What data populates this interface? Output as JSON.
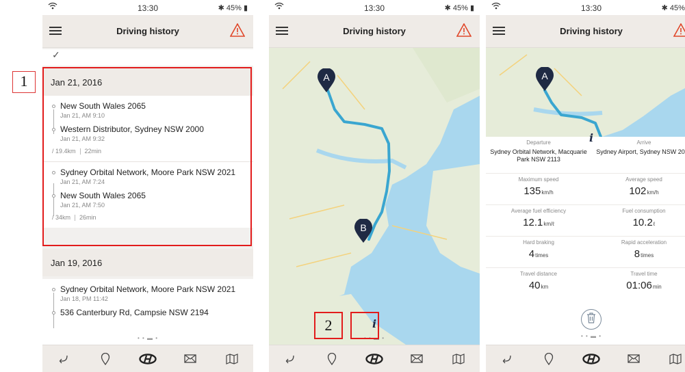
{
  "status": {
    "time": "13:30",
    "battery": "45%"
  },
  "header": {
    "title": "Driving history"
  },
  "history": {
    "groups": [
      {
        "date": "Jan 21, 2016",
        "trips": [
          {
            "start": {
              "place": "New South Wales 2065",
              "time": "Jan 21, AM 9:10"
            },
            "end": {
              "place": "Western Distributor, Sydney NSW 2000",
              "time": "Jan 21, AM 9:32"
            },
            "distance": "19.4km",
            "duration": "22min"
          },
          {
            "start": {
              "place": "Sydney Orbital Network, Moore Park NSW 2021",
              "time": "Jan 21, AM 7:24"
            },
            "end": {
              "place": "New South Wales 2065",
              "time": "Jan 21, AM 7:50"
            },
            "distance": "34km",
            "duration": "26min"
          }
        ]
      },
      {
        "date": "Jan 19, 2016",
        "trips": [
          {
            "start": {
              "place": "Sydney Orbital Network, Moore Park NSW 2021",
              "time": "Jan 18, PM 11:42"
            },
            "end": {
              "place": "536 Canterbury Rd, Campsie NSW 2194",
              "time": ""
            }
          }
        ]
      }
    ]
  },
  "map": {
    "marker_a": "A",
    "marker_b": "B",
    "route_color": "#3aa6d0",
    "water_color": "#a9d7ee",
    "land_color": "#e8eedf",
    "info_label": "i"
  },
  "details": {
    "departure_label": "Departure",
    "departure_value": "Sydney Orbital Network, Macquarie Park NSW 2113",
    "arrive_label": "Arrive",
    "arrive_value": "Sydney Airport, Sydney NSW 2020",
    "max_speed_label": "Maximum speed",
    "max_speed_value": "135",
    "max_speed_unit": "km/h",
    "avg_speed_label": "Average speed",
    "avg_speed_value": "102",
    "avg_speed_unit": "km/h",
    "avg_fuel_label": "Average fuel efficiency",
    "avg_fuel_value": "12.1",
    "avg_fuel_unit": "km/ℓ",
    "fuel_cons_label": "Fuel consumption",
    "fuel_cons_value": "10.2",
    "fuel_cons_unit": "ℓ",
    "hard_braking_label": "Hard braking",
    "hard_braking_value": "4",
    "hard_braking_unit": "times",
    "rapid_acc_label": "Rapid acceleration",
    "rapid_acc_value": "8",
    "rapid_acc_unit": "times",
    "travel_distance_label": "Travel distance",
    "travel_distance_value": "40",
    "travel_distance_unit": "km",
    "travel_time_label": "Travel time",
    "travel_time_value": "01:06",
    "travel_time_unit": "min"
  },
  "callouts": {
    "one": "1",
    "two": "2"
  },
  "nav": {
    "icons": [
      "back-icon",
      "location-pin-icon",
      "hyundai-logo-icon",
      "mail-icon",
      "map-icon"
    ]
  },
  "colors": {
    "accent_red": "#e21b1b",
    "warning": "#e0472a"
  }
}
